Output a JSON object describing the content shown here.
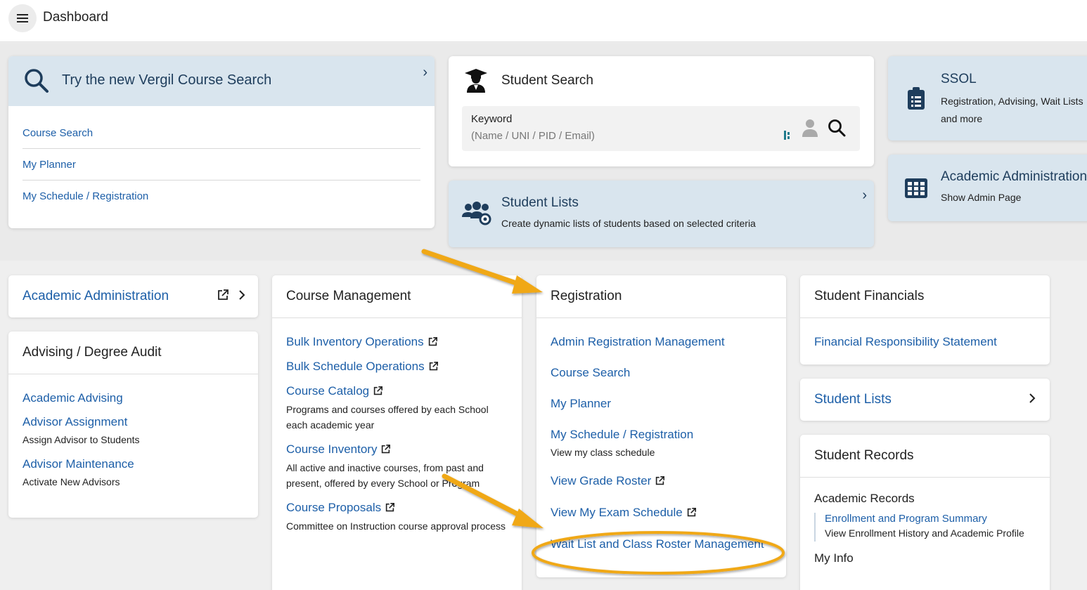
{
  "header": {
    "title": "Dashboard",
    "menu_icon": "hamburger-menu-icon"
  },
  "vergil": {
    "title": "Try the new Vergil Course Search",
    "links": [
      "Course Search",
      "My Planner",
      "My Schedule / Registration"
    ]
  },
  "student_search": {
    "title": "Student Search",
    "keyword_label": "Keyword",
    "keyword_placeholder": "(Name / UNI / PID / Email)"
  },
  "student_lists_top": {
    "title": "Student Lists",
    "subtitle": "Create dynamic lists of students based on selected criteria"
  },
  "ssol": {
    "title": "SSOL",
    "subtitle": "Registration, Advising, Wait Lists and more"
  },
  "academic_admin_top": {
    "title": "Academic Administration",
    "subtitle": "Show Admin Page"
  },
  "academic_admin": {
    "title": "Academic Administration"
  },
  "advising": {
    "title": "Advising / Degree Audit",
    "items": [
      {
        "label": "Academic Advising",
        "desc": ""
      },
      {
        "label": "Advisor Assignment",
        "desc": "Assign Advisor to Students"
      },
      {
        "label": "Advisor Maintenance",
        "desc": "Activate New Advisors"
      }
    ]
  },
  "course_mgmt": {
    "title": "Course Management",
    "items": [
      {
        "label": "Bulk Inventory Operations",
        "desc": ""
      },
      {
        "label": "Bulk Schedule Operations",
        "desc": ""
      },
      {
        "label": "Course Catalog",
        "desc": "Programs and courses offered by each School each academic year"
      },
      {
        "label": "Course Inventory",
        "desc": "All active and inactive courses, from past and present, offered by every School or Program"
      },
      {
        "label": "Course Proposals",
        "desc": "Committee on Instruction course approval process"
      }
    ]
  },
  "registration": {
    "title": "Registration",
    "items": [
      {
        "label": "Admin Registration Management",
        "desc": ""
      },
      {
        "label": "Course Search",
        "desc": ""
      },
      {
        "label": "My Planner",
        "desc": ""
      },
      {
        "label": "My Schedule / Registration",
        "desc": "View my class schedule"
      },
      {
        "label": "View Grade Roster",
        "desc": ""
      },
      {
        "label": "View My Exam Schedule",
        "desc": ""
      },
      {
        "label": "Wait List and Class Roster Management",
        "desc": ""
      }
    ]
  },
  "financials": {
    "title": "Student Financials",
    "items": [
      {
        "label": "Financial Responsibility Statement"
      }
    ]
  },
  "student_lists": {
    "title": "Student Lists"
  },
  "records": {
    "title": "Student Records",
    "section": "Academic Records",
    "link": "Enrollment and Program Summary",
    "link_desc": "View Enrollment History and Academic Profile",
    "more": "My Info"
  },
  "colors": {
    "link": "#1d5fa8",
    "highlight_card": "#d9e5ee",
    "annotation": "#f0a818"
  }
}
